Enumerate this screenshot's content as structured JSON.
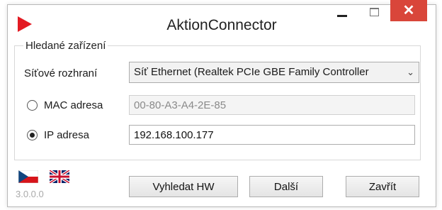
{
  "window": {
    "title": "AktionConnector",
    "close_glyph": "✕"
  },
  "group": {
    "legend": "Hledané zařízení"
  },
  "interface": {
    "label": "Síťové rozhraní",
    "selected": "Síť Ethernet (Realtek PCIe GBE Family Controller",
    "chevron": "⌄"
  },
  "mac": {
    "label": "MAC adresa",
    "value": "00-80-A3-A4-2E-85",
    "selected": false
  },
  "ip": {
    "label": "IP adresa",
    "value": "192.168.100.177",
    "selected": true
  },
  "languages": [
    {
      "code": "cs",
      "icon": "czech-flag-icon"
    },
    {
      "code": "en",
      "icon": "uk-flag-icon"
    }
  ],
  "version": "3.0.0.0",
  "buttons": {
    "find_hw": "Vyhledat HW",
    "next": "Další",
    "close": "Zavřít"
  },
  "colors": {
    "accent_red": "#e31b23",
    "close_button": "#d9463a"
  }
}
